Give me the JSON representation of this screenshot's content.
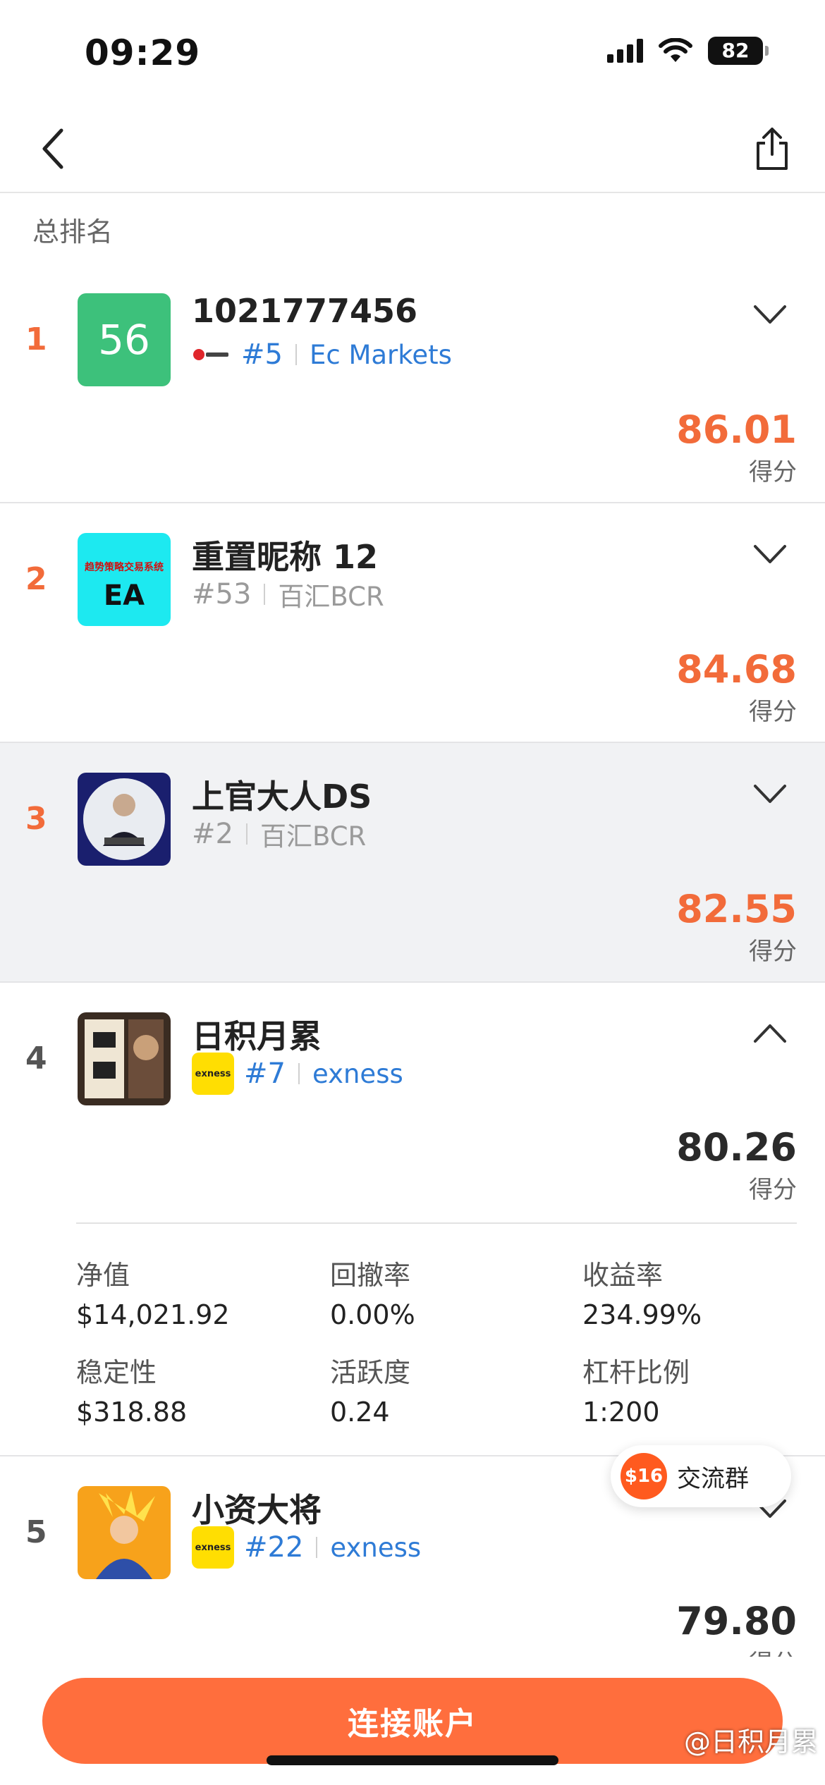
{
  "status_bar": {
    "time": "09:29",
    "battery": "82"
  },
  "section_title": "总排名",
  "rows": [
    {
      "rank": "1",
      "avatar_text": "56",
      "name": "1021777456",
      "rank_tag": "#5",
      "broker": "Ec Markets",
      "score": "86.01",
      "score_label": "得分"
    },
    {
      "rank": "2",
      "avatar_text": "EA",
      "avatar_banner": "趋势策略交易系统",
      "name": "重置昵称 12",
      "rank_tag": "#53",
      "broker": "百汇BCR",
      "score": "84.68",
      "score_label": "得分"
    },
    {
      "rank": "3",
      "name": "上官大人DS",
      "rank_tag": "#2",
      "broker": "百汇BCR",
      "score": "82.55",
      "score_label": "得分"
    },
    {
      "rank": "4",
      "name": "日积月累",
      "rank_tag": "#7",
      "broker": "exness",
      "broker_logo": "exness",
      "score": "80.26",
      "score_label": "得分",
      "stats": [
        {
          "label": "净值",
          "value": "$14,021.92"
        },
        {
          "label": "回撤率",
          "value": "0.00%"
        },
        {
          "label": "收益率",
          "value": "234.99%"
        },
        {
          "label": "稳定性",
          "value": "$318.88"
        },
        {
          "label": "活跃度",
          "value": "0.24"
        },
        {
          "label": "杠杆比例",
          "value": "1:200"
        }
      ]
    },
    {
      "rank": "5",
      "name": "小资大将",
      "rank_tag": "#22",
      "broker": "exness",
      "broker_logo": "exness",
      "score": "79.80",
      "score_label": "得分"
    }
  ],
  "float_button": {
    "badge": "$16",
    "label": "交流群"
  },
  "connect_button": "连接账户",
  "watermark": "@日积月累",
  "colors": {
    "accent": "#f26b3a",
    "link": "#2e7bd6",
    "button": "#ff6e3d"
  }
}
